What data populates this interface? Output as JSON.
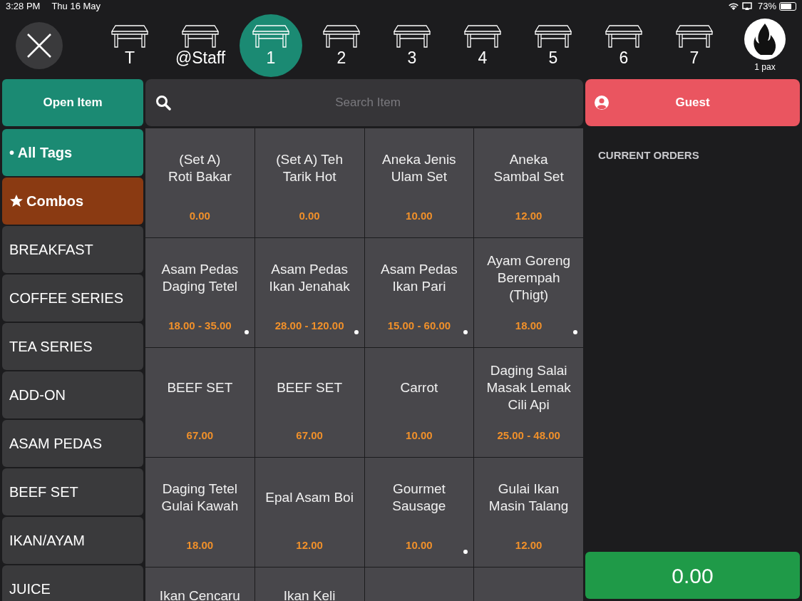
{
  "status_bar": {
    "time": "3:28 PM",
    "date": "Thu 16 May",
    "battery": "73%"
  },
  "tables": [
    {
      "label": "T",
      "selected": false
    },
    {
      "label": "@Staff",
      "selected": false
    },
    {
      "label": "1",
      "selected": true
    },
    {
      "label": "2",
      "selected": false
    },
    {
      "label": "3",
      "selected": false
    },
    {
      "label": "4",
      "selected": false
    },
    {
      "label": "5",
      "selected": false
    },
    {
      "label": "6",
      "selected": false
    },
    {
      "label": "7",
      "selected": false
    }
  ],
  "profile": {
    "pax": "1 pax"
  },
  "open_item": "Open Item",
  "search": {
    "placeholder": "Search Item"
  },
  "guest": "Guest",
  "tags": [
    {
      "label": "• All Tags",
      "kind": "all",
      "selected": true
    },
    {
      "label": "Combos",
      "kind": "combo",
      "selected": false
    },
    {
      "label": "BREAKFAST",
      "kind": "category",
      "selected": false
    },
    {
      "label": "COFFEE SERIES",
      "kind": "category",
      "selected": false
    },
    {
      "label": "TEA SERIES",
      "kind": "category",
      "selected": false
    },
    {
      "label": "ADD-ON",
      "kind": "category",
      "selected": false
    },
    {
      "label": "ASAM PEDAS",
      "kind": "category",
      "selected": false
    },
    {
      "label": "BEEF SET",
      "kind": "category",
      "selected": false
    },
    {
      "label": "IKAN/AYAM",
      "kind": "category",
      "selected": false
    },
    {
      "label": "JUICE",
      "kind": "category",
      "selected": false
    }
  ],
  "items": [
    {
      "name": "(Set A)\nRoti Bakar",
      "price": "0.00",
      "dot": false
    },
    {
      "name": "(Set A) Teh\nTarik Hot",
      "price": "0.00",
      "dot": false
    },
    {
      "name": "Aneka Jenis\nUlam Set",
      "price": "10.00",
      "dot": false
    },
    {
      "name": "Aneka\nSambal Set",
      "price": "12.00",
      "dot": false
    },
    {
      "name": "Asam Pedas\nDaging Tetel",
      "price": "18.00 - 35.00",
      "dot": true
    },
    {
      "name": "Asam Pedas\nIkan Jenahak",
      "price": "28.00 - 120.00",
      "dot": true
    },
    {
      "name": "Asam Pedas\nIkan Pari",
      "price": "15.00 - 60.00",
      "dot": true
    },
    {
      "name": "Ayam Goreng\nBerempah\n(Thigt)",
      "price": "18.00",
      "dot": true
    },
    {
      "name": "BEEF SET",
      "price": "67.00",
      "dot": false
    },
    {
      "name": "BEEF SET",
      "price": "67.00",
      "dot": false
    },
    {
      "name": "Carrot",
      "price": "10.00",
      "dot": false
    },
    {
      "name": "Daging Salai\nMasak Lemak\nCili Api",
      "price": "25.00 - 48.00",
      "dot": false
    },
    {
      "name": "Daging Tetel\nGulai Kawah",
      "price": "18.00",
      "dot": false
    },
    {
      "name": "Epal Asam Boi",
      "price": "12.00",
      "dot": false
    },
    {
      "name": "Gourmet\nSausage",
      "price": "10.00",
      "dot": true
    },
    {
      "name": "Gulai Ikan\nMasin Talang",
      "price": "12.00",
      "dot": false
    },
    {
      "name": "Ikan Cencaru"
    },
    {
      "name": "Ikan Keli"
    }
  ],
  "current_orders": "CURRENT ORDERS",
  "total": "0.00"
}
